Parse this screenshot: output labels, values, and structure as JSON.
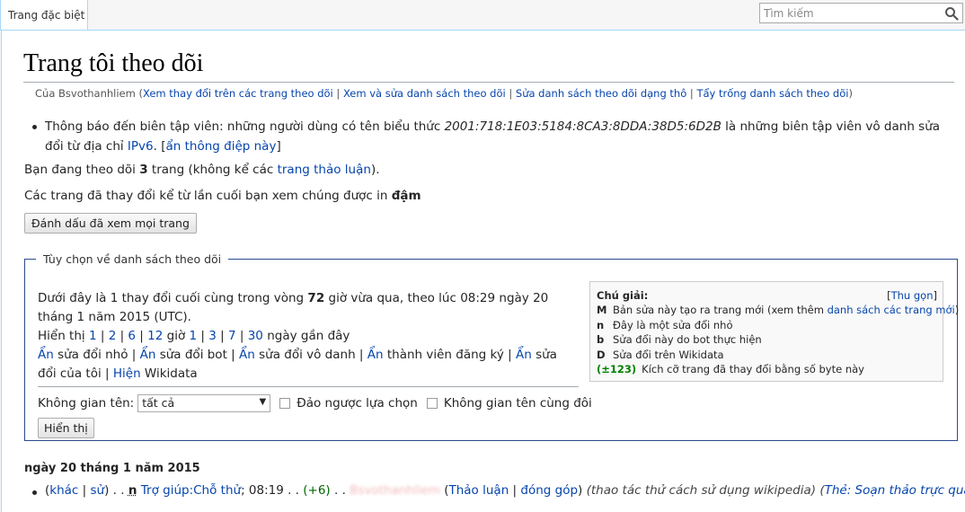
{
  "tabs": {
    "special_page": "Trang đặc biệt"
  },
  "search": {
    "placeholder": "Tìm kiếm"
  },
  "page": {
    "title": "Trang tôi theo dõi",
    "subtitle": {
      "prefix": "Của Bsvothanhliem (",
      "links": [
        "Xem thay đổi trên các trang theo dõi",
        "Xem và sửa danh sách theo dõi",
        "Sửa danh sách theo dõi dạng thô",
        "Tẩy trống danh sách theo dõi"
      ],
      "separator": " | ",
      "suffix": ")"
    }
  },
  "notice": {
    "text_before": "Thông báo đến biên tập viên: những người dùng có tên biểu thức ",
    "ip_pattern": "2001:718:1E03:5184:8CA3:8DDA:38D5:6D2B",
    "text_after": " là những biên tập viên vô danh sửa đổi từ địa chỉ ",
    "ipv6_link": "IPv6",
    "period": ". [",
    "hide_link": "ẩn thông điệp này",
    "close": "]"
  },
  "watch_count": {
    "before": "Bạn đang theo dõi ",
    "count": "3",
    "middle": " trang (không kể các ",
    "talk_link": "trang thảo luận",
    "after": ")."
  },
  "bold_note": {
    "text": "Các trang đã thay đổi kể từ lần cuối bạn xem chúng được in ",
    "bold": "đậm"
  },
  "mark_all_button": "Đánh dấu đã xem mọi trang",
  "options": {
    "legend": "Tùy chọn về danh sách theo dõi",
    "summary_before": "Dưới đây là 1 thay đổi cuối cùng trong vòng ",
    "summary_hours": "72",
    "summary_after": " giờ vừa qua, theo lúc 08:29 ngày 20 tháng 1 năm 2015 (UTC).",
    "show_label": "Hiển thị ",
    "hours": [
      "1",
      "2",
      "6",
      "12"
    ],
    "hours_suffix": " giờ ",
    "days": [
      "1",
      "3",
      "7",
      "30"
    ],
    "days_suffix": " ngày gần đây",
    "hide_links": [
      {
        "link": "Ẩn",
        "text": " sửa đổi nhỏ"
      },
      {
        "link": "Ẩn",
        "text": " sửa đổi bot"
      },
      {
        "link": "Ẩn",
        "text": " sửa đổi vô danh"
      },
      {
        "link": "Ẩn",
        "text": " thành viên đăng ký"
      },
      {
        "link": "Ẩn",
        "text": " sửa đổi của tôi"
      }
    ],
    "show_wikidata_link": "Hiện",
    "show_wikidata_text": " Wikidata",
    "namespace_label": "Không gian tên:",
    "namespace_value": "tất cả",
    "invert_label": "Đảo ngược lựa chọn",
    "associated_label": "Không gian tên cùng đôi",
    "show_button": "Hiển thị"
  },
  "legend": {
    "title": "Chú giải:",
    "hide_link": "Thu gọn",
    "hide_open": "[",
    "hide_close": "]",
    "items": [
      {
        "key": "M",
        "text": "Bản sửa này tạo ra trang mới (xem thêm ",
        "link": "danh sách các trang mới",
        "after": ")"
      },
      {
        "key": "n",
        "text": "Đây là một sửa đổi nhỏ"
      },
      {
        "key": "b",
        "text": "Sửa đổi này do bot thực hiện"
      },
      {
        "key": "D",
        "text": "Sửa đổi trên Wikidata"
      },
      {
        "key": "(±123)",
        "text": "Kích cỡ trang đã thay đổi bằng số byte này"
      }
    ]
  },
  "changes": {
    "date": "ngày 20 tháng 1 năm 2015",
    "rows": [
      {
        "diff_link": "khác",
        "hist_link": "sử",
        "dots": " . . ",
        "flag": "n",
        "page_link": "Trợ giúp:Chỗ thử",
        "time": "; 08:19 . . ",
        "size": "(+6)",
        "dots2": " . . ",
        "user": "Bsvothanhliem",
        "talk_link": "Thảo luận",
        "contribs_link": "đóng góp",
        "summary": "(thao tác thử cách sử dụng wikipedia)",
        "tag_prefix": "(",
        "tag_link": "Thẻ: Soạn thảo trực quan",
        "tag_suffix": ")"
      }
    ]
  }
}
